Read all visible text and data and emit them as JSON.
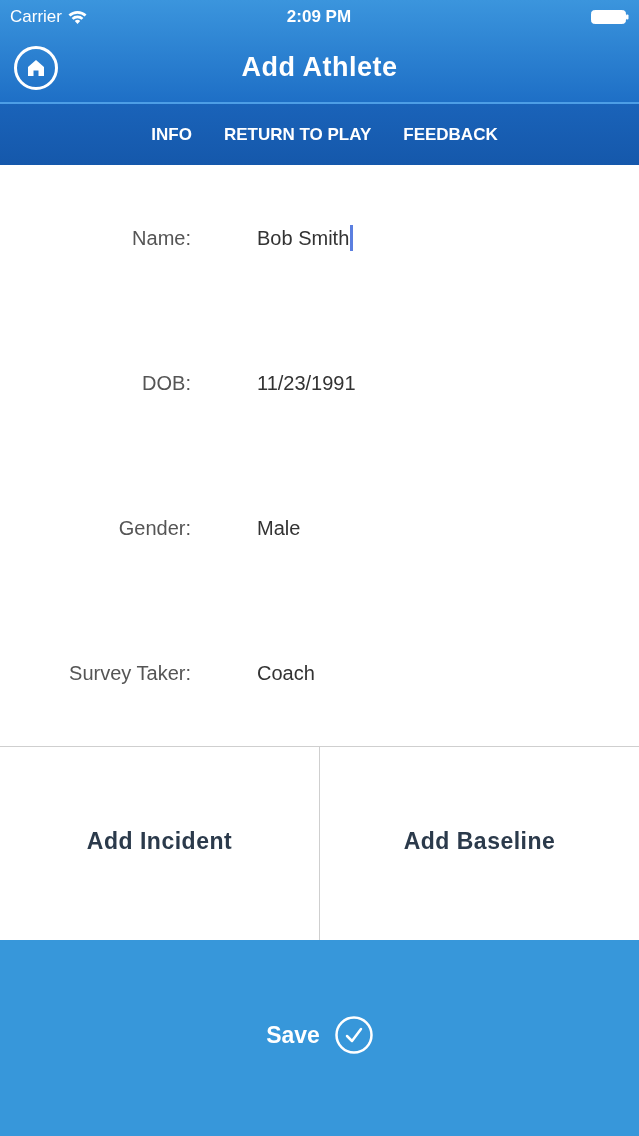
{
  "status_bar": {
    "carrier": "Carrier",
    "time": "2:09 PM"
  },
  "nav_bar": {
    "title": "Add Athlete"
  },
  "tabs": [
    {
      "label": "INFO"
    },
    {
      "label": "RETURN TO PLAY"
    },
    {
      "label": "FEEDBACK"
    }
  ],
  "form": {
    "fields": [
      {
        "label": "Name:",
        "value": "Bob Smith",
        "focused": true
      },
      {
        "label": "DOB:",
        "value": "11/23/1991",
        "focused": false
      },
      {
        "label": "Gender:",
        "value": "Male",
        "focused": false
      },
      {
        "label": "Survey Taker:",
        "value": "Coach",
        "focused": false
      }
    ]
  },
  "actions": [
    {
      "label": "Add Incident"
    },
    {
      "label": "Add Baseline"
    }
  ],
  "save_button": {
    "label": "Save"
  }
}
